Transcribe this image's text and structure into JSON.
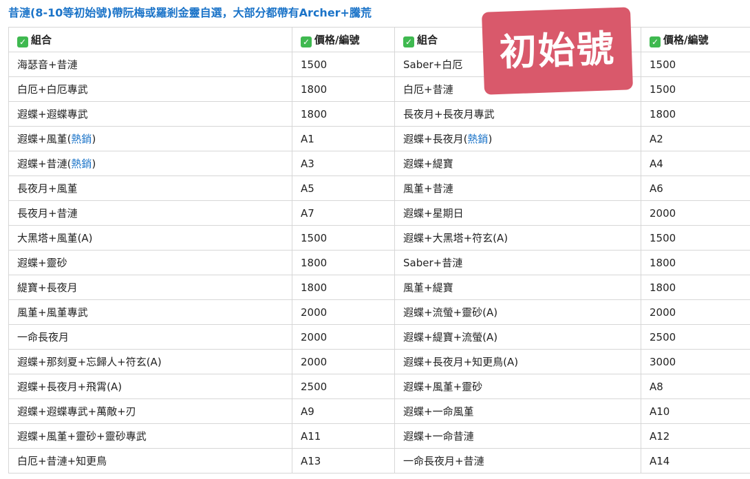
{
  "title": "昔漣(8-10等初始號)帶阮梅或羅剎金靈自選，大部分都帶有Archer+騰荒",
  "stamp": "初始號",
  "header": {
    "combo": "組合",
    "price": "價格/編號",
    "check_icon": "check-icon"
  },
  "colors": {
    "accent": "#1a73c8",
    "stamp": "#d9596b",
    "check": "#3fb950"
  },
  "rows": [
    {
      "l_combo": "海瑟音+昔漣",
      "l_price": "1500",
      "r_combo": "Saber+白厄",
      "r_price": "1500"
    },
    {
      "l_combo": "白厄+白厄專武",
      "l_price": "1800",
      "r_combo": "白厄+昔漣",
      "r_price": "1500"
    },
    {
      "l_combo": "遐蝶+遐蝶專武",
      "l_price": "1800",
      "r_combo": "長夜月+長夜月專武",
      "r_price": "1800"
    },
    {
      "l_combo": "遐蝶+風堇(",
      "l_hot": "熱銷",
      "l_tail": ")",
      "l_price": "A1",
      "r_combo": "遐蝶+長夜月(",
      "r_hot": "熱銷",
      "r_tail": ")",
      "r_price": "A2"
    },
    {
      "l_combo": "遐蝶+昔漣(",
      "l_hot": "熱銷",
      "l_tail": ")",
      "l_price": "A3",
      "r_combo": "遐蝶+緹寶",
      "r_price": "A4"
    },
    {
      "l_combo": "長夜月+風堇",
      "l_price": "A5",
      "r_combo": "風堇+昔漣",
      "r_price": "A6"
    },
    {
      "l_combo": "長夜月+昔漣",
      "l_price": "A7",
      "r_combo": "遐蝶+星期日",
      "r_price": "2000"
    },
    {
      "l_combo": "大黑塔+風堇(A)",
      "l_price": "1500",
      "r_combo": "遐蝶+大黑塔+符玄(A)",
      "r_price": "1500"
    },
    {
      "l_combo": "遐蝶+靈砂",
      "l_price": "1800",
      "r_combo": "Saber+昔漣",
      "r_price": "1800"
    },
    {
      "l_combo": "緹寶+長夜月",
      "l_price": "1800",
      "r_combo": "風堇+緹寶",
      "r_price": "1800"
    },
    {
      "l_combo": "風堇+風堇專武",
      "l_price": "2000",
      "r_combo": "遐蝶+流螢+靈砂(A)",
      "r_price": "2000"
    },
    {
      "l_combo": "一命長夜月",
      "l_price": "2000",
      "r_combo": "遐蝶+緹寶+流螢(A)",
      "r_price": "2500"
    },
    {
      "l_combo": "遐蝶+那刻夏+忘歸人+符玄(A)",
      "l_price": "2000",
      "r_combo": "遐蝶+長夜月+知更鳥(A)",
      "r_price": "3000"
    },
    {
      "l_combo": "遐蝶+長夜月+飛霄(A)",
      "l_price": "2500",
      "r_combo": "遐蝶+風堇+靈砂",
      "r_price": "A8"
    },
    {
      "l_combo": "遐蝶+遐蝶專武+萬敵+刃",
      "l_price": "A9",
      "r_combo": "遐蝶+一命風堇",
      "r_price": "A10"
    },
    {
      "l_combo": "遐蝶+風堇+靈砂+靈砂專武",
      "l_price": "A11",
      "r_combo": "遐蝶+一命昔漣",
      "r_price": "A12"
    },
    {
      "l_combo": "白厄+昔漣+知更鳥",
      "l_price": "A13",
      "r_combo": "一命長夜月+昔漣",
      "r_price": "A14"
    }
  ]
}
